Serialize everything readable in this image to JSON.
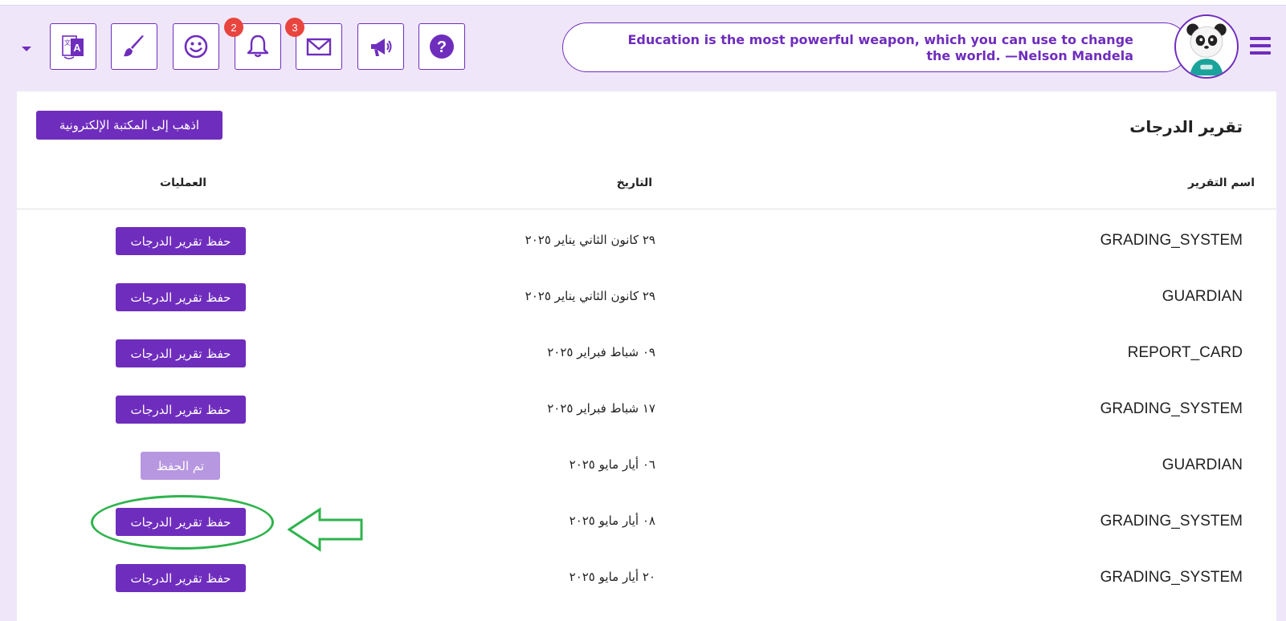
{
  "header": {
    "quote": "Education is the most powerful weapon, which you can use to change the world. —Nelson Mandela",
    "notifications_count": "2",
    "messages_count": "3",
    "icons": [
      "translate-icon",
      "brush-icon",
      "smiley-icon",
      "bell-icon",
      "mail-icon",
      "megaphone-icon",
      "help-icon",
      "menu-icon"
    ],
    "accent_color": "#6f2dbd"
  },
  "page": {
    "title": "تقرير الدرجات",
    "library_button": "اذهب إلى المكتبة الإلكترونية"
  },
  "table": {
    "columns": {
      "name": "اسم التقرير",
      "date": "التاريخ",
      "actions": "العمليات"
    },
    "rows": [
      {
        "name": "GRADING_SYSTEM",
        "date": "٢٩ كانون الثاني يناير ٢٠٢٥",
        "action": "حفظ تقرير الدرجات",
        "saved": false
      },
      {
        "name": "GUARDIAN",
        "date": "٢٩ كانون الثاني يناير ٢٠٢٥",
        "action": "حفظ تقرير الدرجات",
        "saved": false
      },
      {
        "name": "REPORT_CARD",
        "date": "٠٩ شباط فبراير ٢٠٢٥",
        "action": "حفظ تقرير الدرجات",
        "saved": false
      },
      {
        "name": "GRADING_SYSTEM",
        "date": "١٧ شباط فبراير ٢٠٢٥",
        "action": "حفظ تقرير الدرجات",
        "saved": false
      },
      {
        "name": "GUARDIAN",
        "date": "٠٦ أيار مايو ٢٠٢٥",
        "action": "تم الحفظ",
        "saved": true
      },
      {
        "name": "GRADING_SYSTEM",
        "date": "٠٨ أيار مايو ٢٠٢٥",
        "action": "حفظ تقرير الدرجات",
        "saved": false
      },
      {
        "name": "GRADING_SYSTEM",
        "date": "٢٠ أيار مايو ٢٠٢٥",
        "action": "حفظ تقرير الدرجات",
        "saved": false
      }
    ]
  },
  "annotation": {
    "color": "#2fb34d",
    "target_row": 6
  }
}
